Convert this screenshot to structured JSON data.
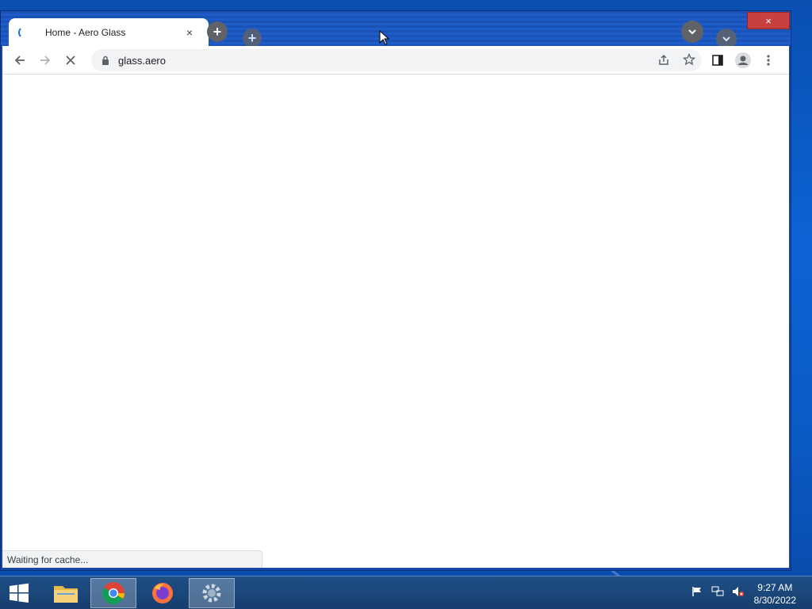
{
  "browser": {
    "tab_title": "Home - Aero Glass",
    "tab_close": "×",
    "new_tab": "+",
    "window_close": "×",
    "url": "glass.aero",
    "status_text": "Waiting for cache..."
  },
  "taskbar": {
    "time": "9:27 AM",
    "date": "8/30/2022"
  },
  "colors": {
    "accent": "#1a73e8",
    "close_red": "#c94040",
    "desktop_blue": "#0d63d6"
  }
}
